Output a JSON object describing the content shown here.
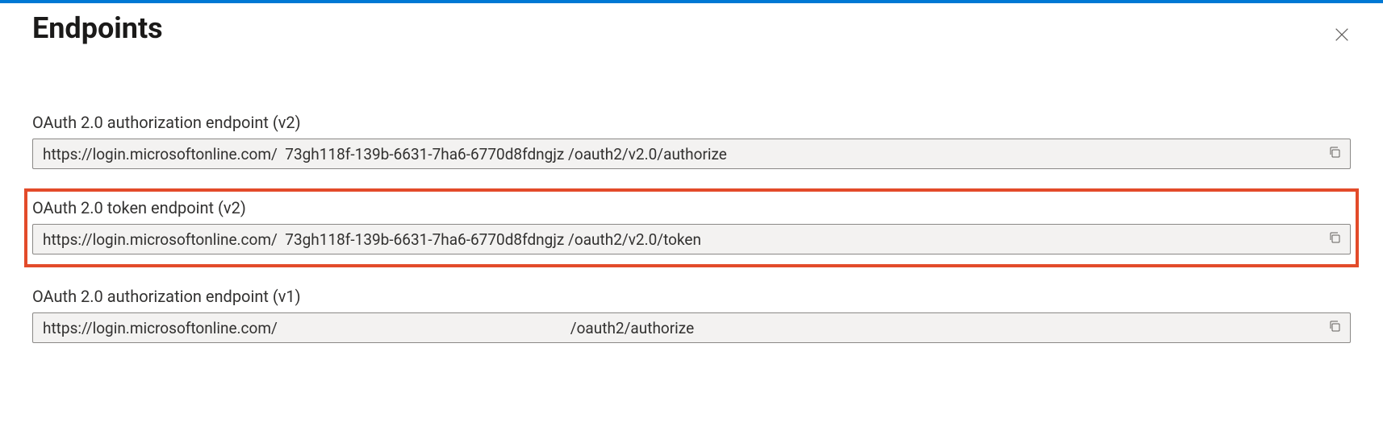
{
  "panel": {
    "title": "Endpoints"
  },
  "endpoints": {
    "authorize_v2": {
      "label": "OAuth 2.0 authorization endpoint (v2)",
      "value": "https://login.microsoftonline.com/  73gh118f-139b-6631-7ha6-6770d8fdngjz /oauth2/v2.0/authorize"
    },
    "token_v2": {
      "label": "OAuth 2.0 token endpoint (v2)",
      "value": "https://login.microsoftonline.com/  73gh118f-139b-6631-7ha6-6770d8fdngjz /oauth2/v2.0/token"
    },
    "authorize_v1": {
      "label": "OAuth 2.0 authorization endpoint (v1)",
      "value": "https://login.microsoftonline.com/                                                                             /oauth2/authorize"
    }
  }
}
